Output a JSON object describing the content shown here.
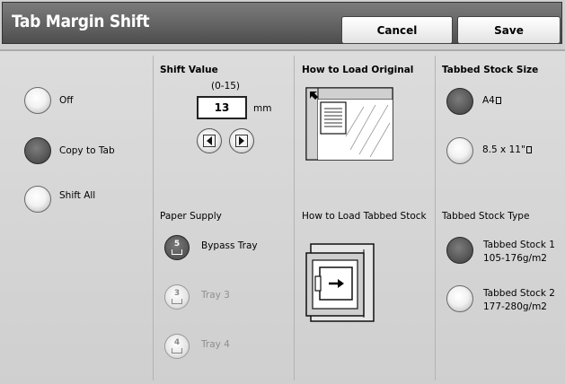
{
  "header": {
    "title": "Tab Margin Shift",
    "cancel_label": "Cancel",
    "save_label": "Save"
  },
  "mode_options": [
    {
      "label": "Off",
      "selected": false
    },
    {
      "label": "Copy to Tab",
      "selected": true
    },
    {
      "label": "Shift All",
      "selected": false
    }
  ],
  "shift_value": {
    "heading": "Shift Value",
    "range": "(0-15)",
    "value": "13",
    "unit": "mm",
    "decrement_icon": "left-arrow-icon",
    "increment_icon": "right-arrow-icon"
  },
  "paper_supply": {
    "heading": "Paper Supply",
    "trays": [
      {
        "number": "5",
        "label": "Bypass Tray",
        "selected": true,
        "enabled": true
      },
      {
        "number": "3",
        "label": "Tray 3",
        "selected": false,
        "enabled": false
      },
      {
        "number": "4",
        "label": "Tray 4",
        "selected": false,
        "enabled": false
      }
    ]
  },
  "load_original": {
    "heading": "How to Load Original"
  },
  "load_tabbed": {
    "heading": "How to Load Tabbed Stock"
  },
  "tabbed_size": {
    "heading": "Tabbed Stock Size",
    "options": [
      {
        "label": "A4",
        "selected": true
      },
      {
        "label": "8.5 x 11\"",
        "selected": false
      }
    ]
  },
  "tabbed_type": {
    "heading": "Tabbed Stock Type",
    "options": [
      {
        "line1": "Tabbed Stock 1",
        "line2": "105-176g/m2",
        "selected": true
      },
      {
        "line1": "Tabbed Stock 2",
        "line2": "177-280g/m2",
        "selected": false
      }
    ]
  }
}
